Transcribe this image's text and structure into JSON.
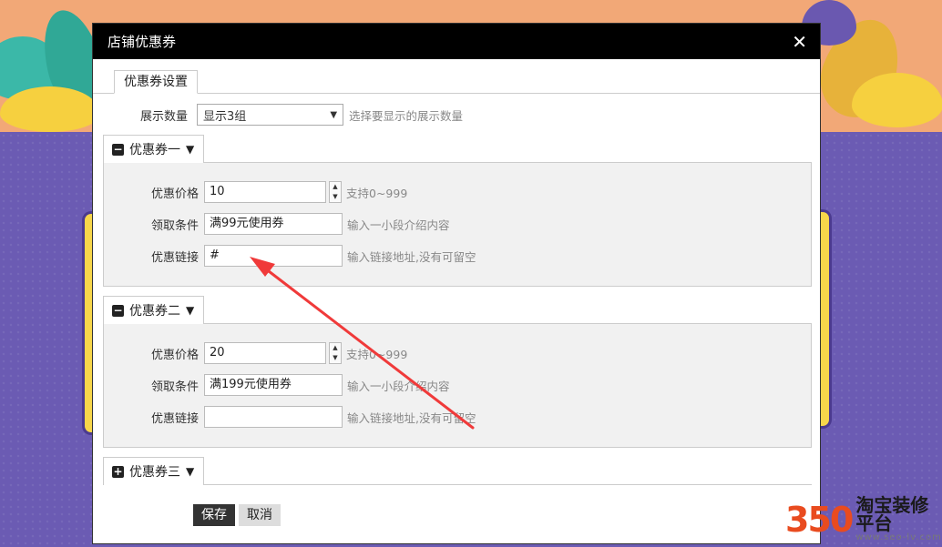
{
  "dialog": {
    "title": "店铺优惠券",
    "close_icon": "✕",
    "tab": "优惠券设置"
  },
  "display": {
    "label": "展示数量",
    "selected": "显示3组",
    "hint": "选择要显示的展示数量"
  },
  "coupons": [
    {
      "title": "优惠券一",
      "toggle": "−",
      "expanded": true,
      "price_label": "优惠价格",
      "price": "10",
      "price_hint": "支持0~999",
      "cond_label": "领取条件",
      "cond": "满99元使用券",
      "cond_hint": "输入一小段介绍内容",
      "link_label": "优惠链接",
      "link": "#",
      "link_hint": "输入链接地址,没有可留空"
    },
    {
      "title": "优惠券二",
      "toggle": "−",
      "expanded": true,
      "price_label": "优惠价格",
      "price": "20",
      "price_hint": "支持0~999",
      "cond_label": "领取条件",
      "cond": "满199元使用券",
      "cond_hint": "输入一小段介绍内容",
      "link_label": "优惠链接",
      "link": "",
      "link_hint": "输入链接地址,没有可留空"
    },
    {
      "title": "优惠券三",
      "toggle": "+",
      "expanded": false
    }
  ],
  "buttons": {
    "save": "保存",
    "cancel": "取消"
  },
  "watermark": {
    "number": "350",
    "name": "淘宝装修平台",
    "url": "www.seo-lv.com"
  },
  "colors": {
    "arrow": "#f03a3a",
    "titlebar": "#000000",
    "save": "#333333"
  }
}
